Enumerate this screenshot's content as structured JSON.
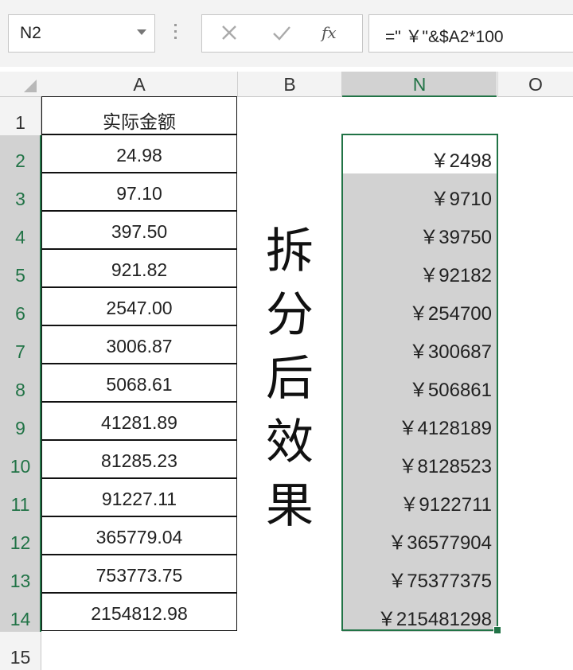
{
  "formula_bar": {
    "name_box": "N2",
    "formula": "=\" ￥\"&$A2*100",
    "fx_label": "fx"
  },
  "columns": [
    "A",
    "B",
    "N",
    "O"
  ],
  "rows": [
    "1",
    "2",
    "3",
    "4",
    "5",
    "6",
    "7",
    "8",
    "9",
    "10",
    "11",
    "12",
    "13",
    "14",
    "15"
  ],
  "column_a": [
    "实际金额",
    "24.98",
    "97.10",
    "397.50",
    "921.82",
    "2547.00",
    "3006.87",
    "5068.61",
    "41281.89",
    "81285.23",
    "91227.11",
    "365779.04",
    "753773.75",
    "2154812.98"
  ],
  "column_n": [
    "￥2498",
    "￥9710",
    "￥39750",
    "￥92182",
    "￥254700",
    "￥300687",
    "￥506861",
    "￥4128189",
    "￥8128523",
    "￥9122711",
    "￥36577904",
    "￥75377375",
    "￥215481298"
  ],
  "big_label": [
    "拆",
    "分",
    "后",
    "效",
    "果"
  ],
  "colors": {
    "accent": "#217346",
    "highlight": "#d2d2d2"
  }
}
